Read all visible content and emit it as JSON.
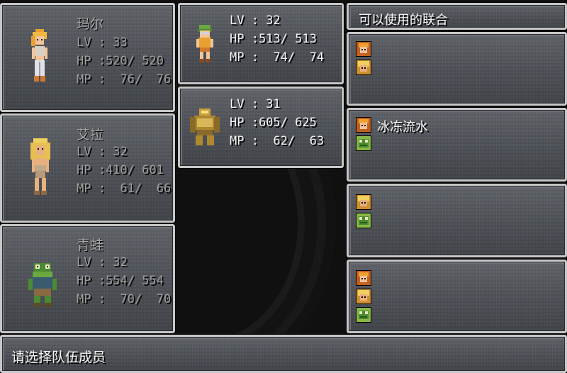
{
  "party_left": [
    {
      "name": "玛尔",
      "lv": "LV : 33",
      "hp": "HP :520/ 520",
      "mp": "MP :  76/  76",
      "sprite": "marle-sprite"
    },
    {
      "name": "艾拉",
      "lv": "LV : 32",
      "hp": "HP :410/ 601",
      "mp": "MP :  61/  66",
      "sprite": "ayla-sprite"
    },
    {
      "name": "青蛙",
      "lv": "LV : 32",
      "hp": "HP :554/ 554",
      "mp": "MP :  70/  70",
      "sprite": "frog-sprite"
    }
  ],
  "party_center": [
    {
      "lv": "LV : 32",
      "hp": "HP :513/ 513",
      "mp": "MP :  74/  74",
      "sprite": "lucca-sprite"
    },
    {
      "lv": "LV : 31",
      "hp": "HP :605/ 625",
      "mp": "MP :  62/  63",
      "sprite": "robo-sprite"
    }
  ],
  "techs": {
    "header": "可以使用的联合",
    "items": [
      {
        "name": "",
        "faces": [
          "marle",
          "ayla"
        ]
      },
      {
        "name": "冰冻流水",
        "faces": [
          "marle",
          "frog"
        ]
      },
      {
        "name": "",
        "faces": [
          "ayla",
          "frog"
        ]
      },
      {
        "name": "",
        "faces": [
          "marle",
          "ayla",
          "frog"
        ]
      }
    ]
  },
  "prompt": "请选择队伍成员",
  "colors": {
    "panel": "#4e5258",
    "border": "#c7c7c7",
    "text_bright": "#f2f2f2",
    "text_dim": "#9c9c9c"
  }
}
